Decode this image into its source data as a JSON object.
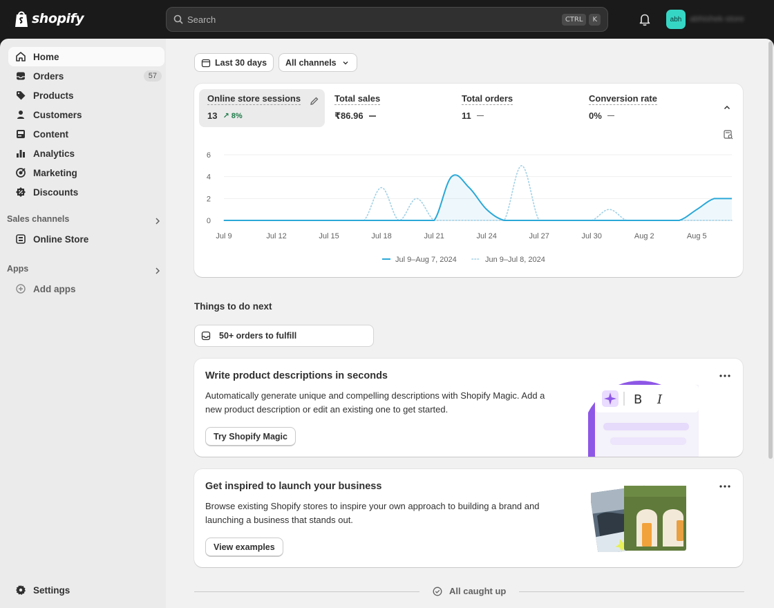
{
  "brand": {
    "name": "shopify"
  },
  "search": {
    "placeholder": "Search",
    "shortcut_keys": [
      "CTRL",
      "K"
    ]
  },
  "user": {
    "avatar_initials": "abh",
    "store_name": "abhishek-store"
  },
  "sidebar": {
    "items": [
      {
        "label": "Home",
        "icon": "home-icon",
        "active": true
      },
      {
        "label": "Orders",
        "icon": "inbox-icon",
        "count": "57"
      },
      {
        "label": "Products",
        "icon": "tag-icon"
      },
      {
        "label": "Customers",
        "icon": "person-icon"
      },
      {
        "label": "Content",
        "icon": "image-icon"
      },
      {
        "label": "Analytics",
        "icon": "bar-chart-icon"
      },
      {
        "label": "Marketing",
        "icon": "target-icon"
      },
      {
        "label": "Discounts",
        "icon": "discount-icon"
      }
    ],
    "sales_channels_title": "Sales channels",
    "online_store": "Online Store",
    "apps_title": "Apps",
    "add_apps": "Add apps",
    "settings": "Settings"
  },
  "filters": {
    "date_range": "Last 30 days",
    "channels": "All channels"
  },
  "metrics": [
    {
      "label": "Online store sessions",
      "value": "13",
      "delta": "8%",
      "selected": true
    },
    {
      "label": "Total sales",
      "value": "₹86.96"
    },
    {
      "label": "Total orders",
      "value": "11"
    },
    {
      "label": "Conversion rate",
      "value": "0%"
    }
  ],
  "chart_data": {
    "type": "line",
    "x": [
      "Jul 9",
      "Jul 10",
      "Jul 11",
      "Jul 12",
      "Jul 13",
      "Jul 14",
      "Jul 15",
      "Jul 16",
      "Jul 17",
      "Jul 18",
      "Jul 19",
      "Jul 20",
      "Jul 21",
      "Jul 22",
      "Jul 23",
      "Jul 24",
      "Jul 25",
      "Jul 26",
      "Jul 27",
      "Jul 28",
      "Jul 29",
      "Jul 30",
      "Jul 31",
      "Aug 1",
      "Aug 2",
      "Aug 3",
      "Aug 4",
      "Aug 5",
      "Aug 6",
      "Aug 7"
    ],
    "tick_labels": [
      "Jul 9",
      "Jul 12",
      "Jul 15",
      "Jul 18",
      "Jul 21",
      "Jul 24",
      "Jul 27",
      "Jul 30",
      "Aug 2",
      "Aug 5"
    ],
    "yticks": [
      0,
      2,
      4,
      6
    ],
    "ylim": [
      0,
      6
    ],
    "series": [
      {
        "name": "Jul 9–Aug 7, 2024",
        "style": "solid",
        "color": "#2aa8d8",
        "values": [
          0,
          0,
          0,
          0,
          0,
          0,
          0,
          0,
          0,
          0,
          0,
          0,
          0,
          4,
          3,
          1,
          0,
          0,
          0,
          0,
          0,
          0,
          0,
          0,
          0,
          0,
          0,
          1,
          2,
          2
        ]
      },
      {
        "name": "Jun 9–Jul 8, 2024",
        "style": "dotted",
        "color": "#9fd0e6",
        "values": [
          0,
          0,
          0,
          0,
          0,
          0,
          0,
          0,
          0,
          3,
          0,
          2,
          0,
          0,
          0,
          0,
          0,
          5,
          0,
          0,
          0,
          0,
          1,
          0,
          0,
          0,
          0,
          0,
          0,
          0
        ]
      }
    ],
    "grid": true,
    "legend_position": "bottom"
  },
  "todo": {
    "title": "Things to do next",
    "orders_button": "50+ orders to fulfill"
  },
  "cards": [
    {
      "title": "Write product descriptions in seconds",
      "body": "Automatically generate unique and compelling descriptions with Shopify Magic. Add a new product description or edit an existing one to get started.",
      "button": "Try Shopify Magic"
    },
    {
      "title": "Get inspired to launch your business",
      "body": "Browse existing Shopify stores to inspire your own approach to building a brand and launching a business that stands out.",
      "button": "View examples"
    }
  ],
  "footer": {
    "all_caught_up": "All caught up"
  }
}
